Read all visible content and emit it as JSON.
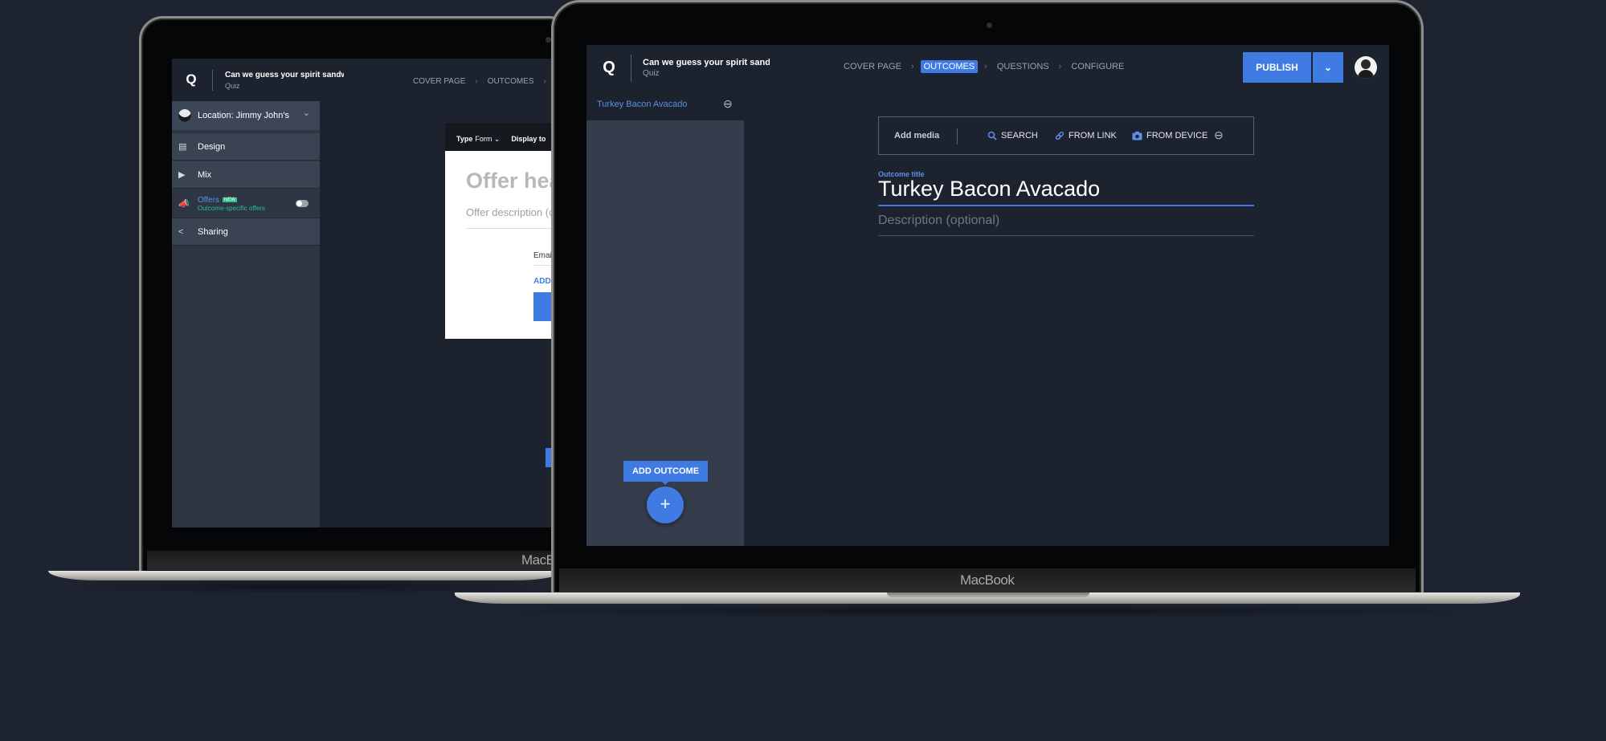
{
  "colors": {
    "background": "#1d2430",
    "app_bg": "#1c232f",
    "accent": "#3f7be3",
    "sidebar": "#2e3644",
    "new_badge": "#2fbf8f"
  },
  "quiz": {
    "title": "Can we guess your spirit sandwich",
    "type_label": "Quiz"
  },
  "steps": [
    "COVER PAGE",
    "OUTCOMES",
    "QUESTIONS",
    "CONFIGURE"
  ],
  "active_step": "OUTCOMES",
  "icons": {
    "logo": "Q",
    "chevron": "›",
    "dropdown": "⌄",
    "collapse": "⊖",
    "plus": "+",
    "search": "search-icon",
    "link": "link-icon",
    "camera": "camera-icon"
  },
  "back": {
    "location": "Location: Jimmy John's",
    "menu": [
      {
        "label": "Design",
        "icon": "design-icon"
      },
      {
        "label": "Mix",
        "icon": "play-icon"
      },
      {
        "label": "Offers",
        "badge": "NEW",
        "sub": "Outcome-specific offers",
        "icon": "megaphone-icon",
        "toggle": false
      },
      {
        "label": "Sharing",
        "icon": "share-icon"
      }
    ],
    "offer": {
      "type_label": "Type",
      "type_value": "Form",
      "display_label": "Display to",
      "heading": "Offer headline",
      "description": "Offer description (optional)",
      "email_label": "Email",
      "add_label": "ADD FIELD"
    },
    "brand": "MacBook"
  },
  "front": {
    "outcomes": [
      "Turkey Bacon Avacado"
    ],
    "add_outcome": "ADD OUTCOME",
    "publish": "PUBLISH",
    "media": {
      "label": "Add media",
      "search": "SEARCH",
      "link": "FROM LINK",
      "device": "FROM DEVICE"
    },
    "outcome_title_label": "Outcome title",
    "outcome_title": "Turkey Bacon Avacado",
    "description_placeholder": "Description (optional)",
    "brand": "MacBook"
  }
}
